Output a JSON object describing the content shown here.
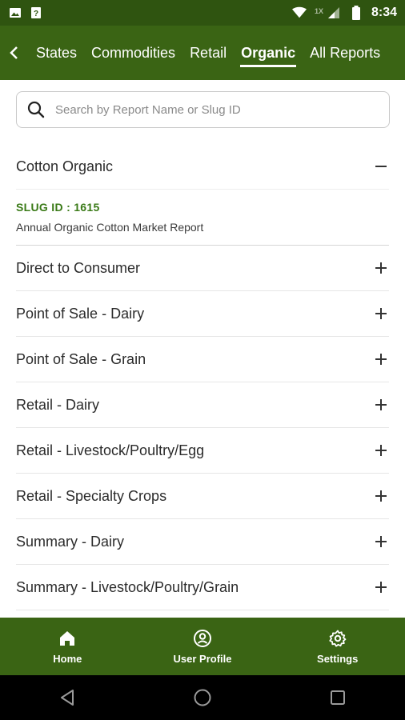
{
  "status_bar": {
    "time": "8:34",
    "network_label": "1X"
  },
  "nav": {
    "tabs": [
      {
        "label": "States",
        "active": false
      },
      {
        "label": "Commodities",
        "active": false
      },
      {
        "label": "Retail",
        "active": false
      },
      {
        "label": "Organic",
        "active": true
      },
      {
        "label": "All Reports",
        "active": false
      }
    ]
  },
  "search": {
    "placeholder": "Search by Report Name or Slug ID",
    "value": ""
  },
  "list": {
    "expanded_item": {
      "label": "Cotton Organic",
      "toggle_icon": "minus-icon",
      "slug_id": "SLUG ID : 1615",
      "report_name": "Annual Organic Cotton Market Report"
    },
    "items": [
      {
        "label": "Direct to Consumer",
        "toggle_icon": "plus-icon"
      },
      {
        "label": "Point of Sale - Dairy",
        "toggle_icon": "plus-icon"
      },
      {
        "label": "Point of Sale - Grain",
        "toggle_icon": "plus-icon"
      },
      {
        "label": "Retail - Dairy",
        "toggle_icon": "plus-icon"
      },
      {
        "label": "Retail - Livestock/Poultry/Egg",
        "toggle_icon": "plus-icon"
      },
      {
        "label": "Retail - Specialty Crops",
        "toggle_icon": "plus-icon"
      },
      {
        "label": "Summary - Dairy",
        "toggle_icon": "plus-icon"
      },
      {
        "label": "Summary - Livestock/Poultry/Grain",
        "toggle_icon": "plus-icon"
      }
    ]
  },
  "bottom_nav": {
    "items": [
      {
        "label": "Home",
        "icon": "home-icon"
      },
      {
        "label": "User Profile",
        "icon": "user-profile-icon"
      },
      {
        "label": "Settings",
        "icon": "gear-icon"
      }
    ]
  },
  "colors": {
    "header_green": "#3a6414",
    "status_green": "#2f5410",
    "slug_green": "#3a7a17"
  }
}
